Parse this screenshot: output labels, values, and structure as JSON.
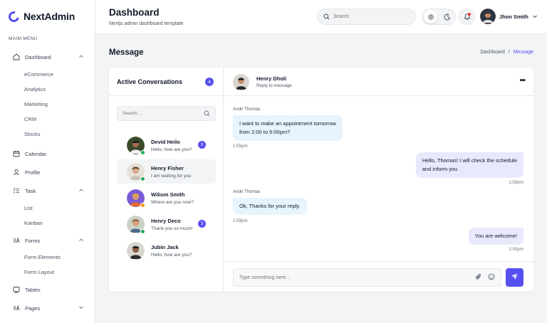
{
  "brand": {
    "name": "NextAdmin",
    "accent": "#5750f1"
  },
  "sidebar": {
    "menu_title": "MAIM MENU",
    "dashboard": {
      "label": "Dashboard",
      "icon": "home-icon",
      "children": [
        "eCommerce",
        "Analytics",
        "Marketing",
        "CRM",
        "Stocks"
      ]
    },
    "calendar": {
      "label": "Calendar",
      "icon": "calendar-icon"
    },
    "profile": {
      "label": "Profile",
      "icon": "user-icon"
    },
    "task": {
      "label": "Task",
      "icon": "list-icon",
      "children": [
        "List",
        "Kanban"
      ]
    },
    "forms": {
      "label": "Forms",
      "icon": "forms-icon",
      "children": [
        "Form Elements",
        "Form Layout"
      ]
    },
    "tables": {
      "label": "Tables",
      "icon": "table-icon"
    },
    "pages": {
      "label": "Pages",
      "icon": "pages-icon"
    }
  },
  "header": {
    "title": "Dashboard",
    "subtitle": "Nextjs admin dashboard template",
    "search_placeholder": "Search",
    "user_name": "Jhon Smith"
  },
  "page": {
    "title": "Message",
    "breadcrumb_parent": "Dashboard",
    "breadcrumb_sep": "/",
    "breadcrumb_current": "Message"
  },
  "conversations": {
    "title": "Active Conversations",
    "count": "4",
    "search_placeholder": "Search...",
    "items": [
      {
        "name": "Devid Heilo",
        "message": "Hello, how are you?",
        "badge": "3",
        "status": "online"
      },
      {
        "name": "Henry Fisher",
        "message": "I am waiting for you",
        "badge": "",
        "status": "online"
      },
      {
        "name": "Wilium Smith",
        "message": "Where are you now?",
        "badge": "",
        "status": "away"
      },
      {
        "name": "Henry Deco",
        "message": "Thank you so much!",
        "badge": "3",
        "status": "online"
      },
      {
        "name": "Jubin Jack",
        "message": "Hello, how are you?",
        "badge": "",
        "status": "none"
      }
    ]
  },
  "chat": {
    "contact_name": "Henry Dholi",
    "contact_sub": "Reply to message",
    "messages": [
      {
        "sender": "Andri Thomas",
        "text_line1": "I want to make an appointment tomorrow",
        "text_line2": "from 2:00 to 5:00pm?",
        "time": "1:55pm",
        "direction": "in"
      },
      {
        "sender": "",
        "text_line1": "Hello, Thomas! I will check the schedule",
        "text_line2": "and inform you",
        "time": "1:58pm",
        "direction": "out"
      },
      {
        "sender": "Andri Thomas",
        "text_line1": "Ok, Thanks for your reply.",
        "text_line2": "",
        "time": "1:59pm",
        "direction": "in"
      },
      {
        "sender": "",
        "text_line1": "You are welcome!",
        "text_line2": "",
        "time": "2:00pm",
        "direction": "out"
      }
    ],
    "input_placeholder": "Type something here..."
  },
  "colors": {
    "online": "#22ad5c",
    "away": "#f59e0b",
    "badge": "#5750f1",
    "bubble_in": "#e8f4fd",
    "bubble_out": "#e8e9fb"
  }
}
